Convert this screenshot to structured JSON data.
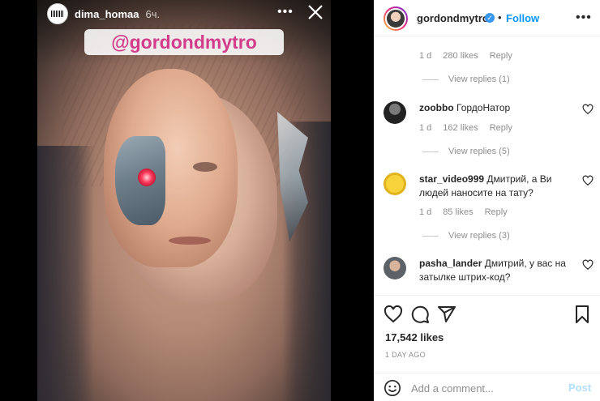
{
  "story": {
    "username": "dima_homaa",
    "time": "6ч.",
    "mention": "@gordondmytro",
    "more_label": "•••"
  },
  "post_header": {
    "username": "gordondmytro",
    "verified_mark": "✓",
    "dot": "•",
    "follow_label": "Follow",
    "more_label": "•••"
  },
  "comments": {
    "top_meta": {
      "age": "1 d",
      "likes": "280 likes",
      "reply": "Reply"
    },
    "top_view_replies": "View replies (1)",
    "items": [
      {
        "user": "zoobbo",
        "text": "ГордоНатор",
        "age": "1 d",
        "likes": "162 likes",
        "reply": "Reply",
        "view_replies": "View replies (5)"
      },
      {
        "user": "star_video999",
        "text": "Дмитрий, а Ви людей наносите на тату?",
        "age": "1 d",
        "likes": "85 likes",
        "reply": "Reply",
        "view_replies": "View replies (3)"
      },
      {
        "user": "pasha_lander",
        "text": "Дмитрий, у вас на затылке штрих-код?",
        "age": "",
        "likes": "",
        "reply": "",
        "view_replies": ""
      }
    ]
  },
  "actions": {
    "likes": "17,542 likes",
    "ago": "1 DAY AGO"
  },
  "add_comment": {
    "placeholder": "Add a comment...",
    "post_label": "Post"
  },
  "colors": {
    "link_blue": "#0095f6",
    "verified_blue": "#3897f0",
    "mention_pink": "#d23c8a",
    "post_disabled": "#b2dffc"
  }
}
